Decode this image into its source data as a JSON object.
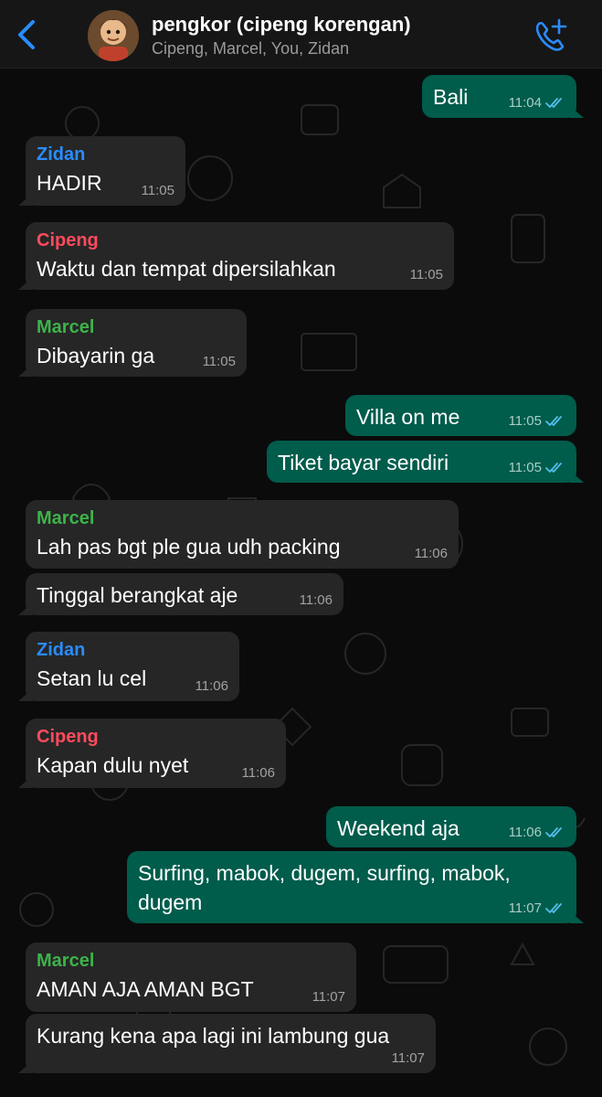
{
  "header": {
    "back_icon": "chevron-left-icon",
    "title": "pengkor (cipeng korengan)",
    "subtitle": "Cipeng, Marcel, You, Zidan",
    "call_icon": "phone-add-icon"
  },
  "colors": {
    "accent": "#2a8cff",
    "outgoing_bubble": "#005c4b",
    "incoming_bubble": "#262626",
    "Zidan": "#2a8cff",
    "Cipeng": "#ff4b5c",
    "Marcel": "#3cb44a",
    "read_ticks": "#53bdeb"
  },
  "messages": [
    {
      "direction": "out",
      "text": "Bali",
      "time": "11:04",
      "read": true
    },
    {
      "direction": "in",
      "sender": "Zidan",
      "text": "HADIR",
      "time": "11:05"
    },
    {
      "direction": "in",
      "sender": "Cipeng",
      "text": "Waktu dan tempat dipersilahkan",
      "time": "11:05"
    },
    {
      "direction": "in",
      "sender": "Marcel",
      "text": "Dibayarin ga",
      "time": "11:05"
    },
    {
      "direction": "out",
      "text": "Villa on me",
      "time": "11:05",
      "read": true
    },
    {
      "direction": "out",
      "text": "Tiket bayar sendiri",
      "time": "11:05",
      "read": true
    },
    {
      "direction": "in",
      "sender": "Marcel",
      "text": "Lah pas bgt ple gua udh packing",
      "time": "11:06"
    },
    {
      "direction": "in",
      "text": "Tinggal berangkat aje",
      "time": "11:06"
    },
    {
      "direction": "in",
      "sender": "Zidan",
      "text": "Setan lu cel",
      "time": "11:06"
    },
    {
      "direction": "in",
      "sender": "Cipeng",
      "text": "Kapan dulu nyet",
      "time": "11:06"
    },
    {
      "direction": "out",
      "text": "Weekend aja",
      "time": "11:06",
      "read": true
    },
    {
      "direction": "out",
      "text": "Surfing, mabok, dugem, surfing, mabok,\ndugem",
      "time": "11:07",
      "read": true
    },
    {
      "direction": "in",
      "sender": "Marcel",
      "text": "AMAN AJA AMAN BGT",
      "time": "11:07"
    },
    {
      "direction": "in",
      "text": "Kurang kena apa lagi ini lambung gua",
      "time": "11:07"
    }
  ]
}
